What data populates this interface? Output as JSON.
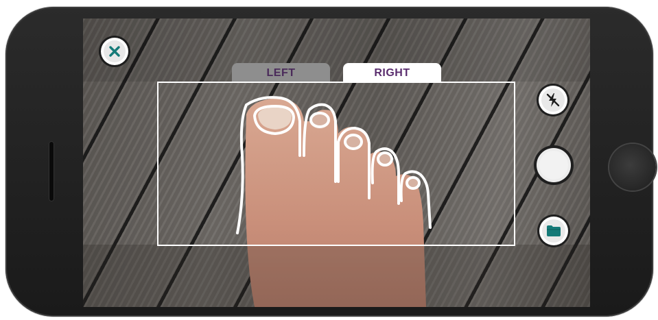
{
  "tabs": {
    "left_label": "LEFT",
    "right_label": "RIGHT",
    "selected": "RIGHT"
  },
  "icons": {
    "close": "close-icon",
    "flash_off": "flash-off-icon",
    "shutter": "shutter-icon",
    "folder": "folder-icon"
  },
  "colors": {
    "accent_teal": "#157a78",
    "tab_text_purple": "#5a2d6e",
    "guide_frame": "#ffffff"
  }
}
